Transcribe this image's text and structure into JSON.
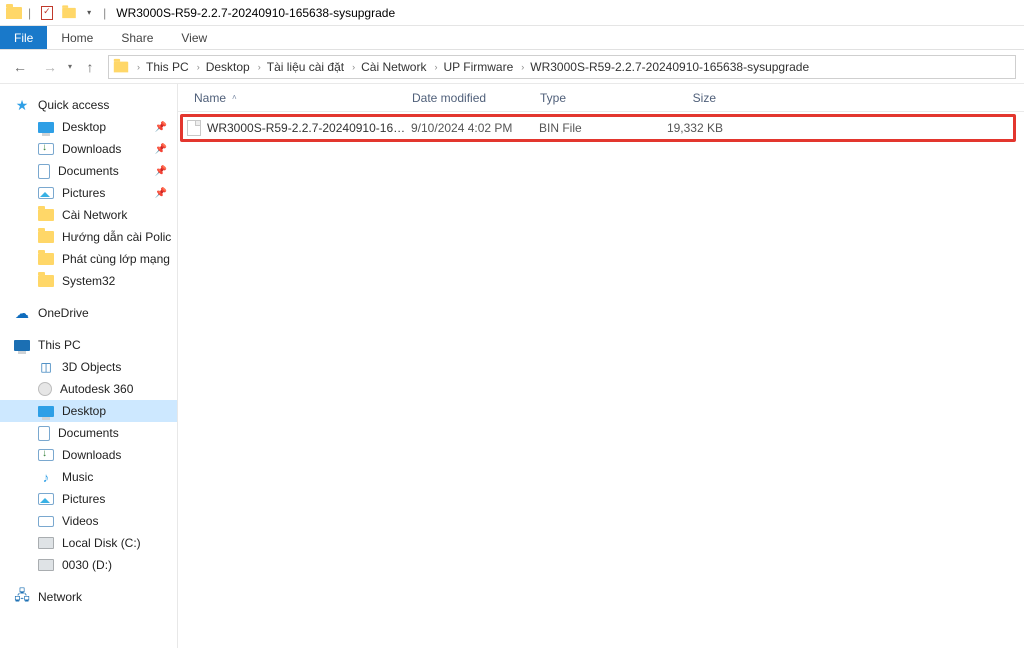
{
  "title": "WR3000S-R59-2.2.7-20240910-165638-sysupgrade",
  "ribbon": {
    "file": "File",
    "tabs": [
      "Home",
      "Share",
      "View"
    ]
  },
  "breadcrumbs": [
    "This PC",
    "Desktop",
    "Tài liệu cài đặt",
    "Cài Network",
    "UP Firmware",
    "WR3000S-R59-2.2.7-20240910-165638-sysupgrade"
  ],
  "columns": {
    "name": "Name",
    "date": "Date modified",
    "type": "Type",
    "size": "Size"
  },
  "file": {
    "name": "WR3000S-R59-2.2.7-20240910-165638-sys...",
    "date": "9/10/2024 4:02 PM",
    "type": "BIN File",
    "size": "19,332 KB"
  },
  "sidebar": {
    "quick_access": "Quick access",
    "qa_items": [
      {
        "label": "Desktop",
        "icon": "desktop",
        "pin": true
      },
      {
        "label": "Downloads",
        "icon": "down",
        "pin": true
      },
      {
        "label": "Documents",
        "icon": "doc",
        "pin": true
      },
      {
        "label": "Pictures",
        "icon": "pic",
        "pin": true
      },
      {
        "label": "Cài Network",
        "icon": "folder"
      },
      {
        "label": "Hướng dẫn cài Polic",
        "icon": "folder"
      },
      {
        "label": "Phát cùng lớp mạng",
        "icon": "folder"
      },
      {
        "label": "System32",
        "icon": "folder"
      }
    ],
    "onedrive": "OneDrive",
    "this_pc": "This PC",
    "pc_items": [
      {
        "label": "3D Objects",
        "icon": "3d"
      },
      {
        "label": "Autodesk 360",
        "icon": "autodesk"
      },
      {
        "label": "Desktop",
        "icon": "desktop",
        "selected": true
      },
      {
        "label": "Documents",
        "icon": "doc"
      },
      {
        "label": "Downloads",
        "icon": "down"
      },
      {
        "label": "Music",
        "icon": "music"
      },
      {
        "label": "Pictures",
        "icon": "pic"
      },
      {
        "label": "Videos",
        "icon": "video"
      },
      {
        "label": "Local Disk (C:)",
        "icon": "disk"
      },
      {
        "label": "0030 (D:)",
        "icon": "disk"
      }
    ],
    "network": "Network"
  }
}
